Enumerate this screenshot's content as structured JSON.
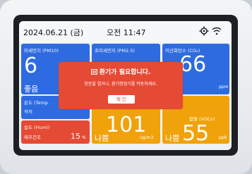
{
  "status": {
    "date": "2024.06.21 (금)",
    "time": "오전 11:47",
    "settings_icon": "gear-icon",
    "wifi_icon": "wifi-icon"
  },
  "tiles": {
    "pm10": {
      "label": "미세먼지 (PM10)",
      "big": "6",
      "status": "좋음",
      "color": "#2f6be0"
    },
    "pm25": {
      "label": "초미세먼지 (PM2.5)",
      "color": "#2f6be0"
    },
    "co2": {
      "label": "이산화탄소 (CO₂)",
      "big": "66",
      "unit": "ppm",
      "color": "#2f6be0"
    },
    "temp": {
      "label": "온도 (Temp",
      "status": "적적",
      "color": "#2f6be0"
    },
    "voc": {
      "label": "합물 (VOCs)",
      "big": "55",
      "status": "나쁨",
      "unit": "ppb",
      "color": "#f0a20a"
    },
    "humi": {
      "label": "습도 (Humi)",
      "status": "매우건조",
      "value": "15",
      "unit": "%",
      "color": "#e54a34"
    },
    "pm25_low": {
      "big": "101",
      "status": "나쁨",
      "unit": "ug/m3",
      "color": "#f0a20a"
    }
  },
  "popup": {
    "title": "환기가 필요합니다.",
    "message": "창문을 열거나, 환기청정기를 작동하세요.",
    "confirm": "확 인",
    "icon": "ventilation-icon"
  },
  "pager": "• • •"
}
